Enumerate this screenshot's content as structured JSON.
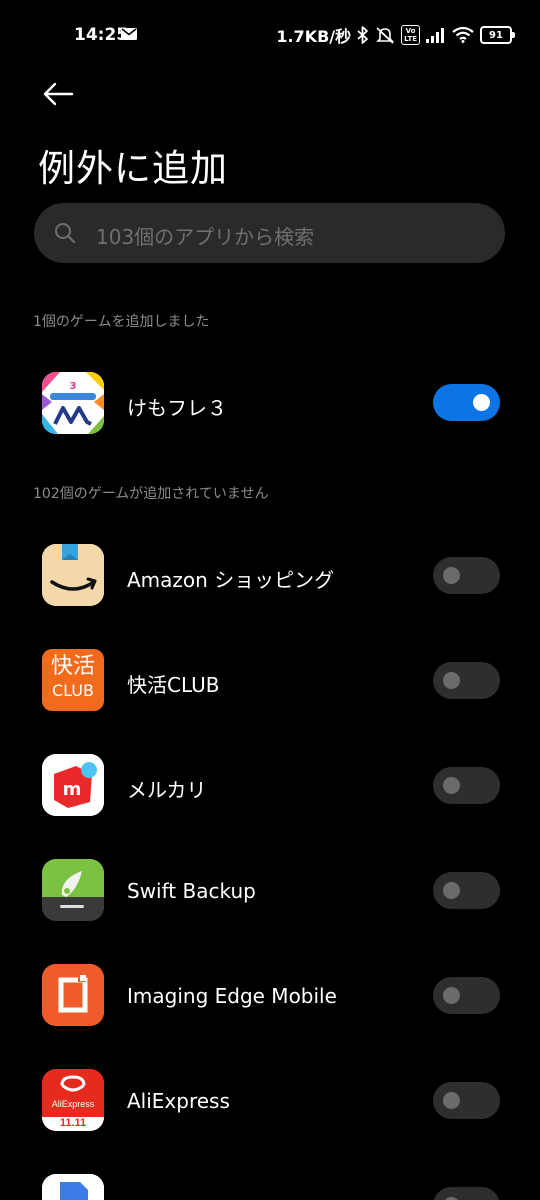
{
  "status_bar": {
    "time": "14:25",
    "net_speed": "1.7KB/秒",
    "battery": "91",
    "volte": "Vo\nLTE"
  },
  "header": {
    "title": "例外に追加"
  },
  "search": {
    "placeholder": "103個のアプリから検索"
  },
  "sections": {
    "added_header": "1個のゲームを追加しました",
    "not_added_header": "102個のゲームが追加されていません"
  },
  "added_apps": [
    {
      "name": "けもフレ３",
      "enabled": true,
      "icon": "kemofure-icon"
    }
  ],
  "apps": [
    {
      "name": "Amazon ショッピング",
      "enabled": false,
      "icon": "amazon-icon"
    },
    {
      "name": "快活CLUB",
      "enabled": false,
      "icon": "kaikatsu-icon",
      "icon_text_1": "快活",
      "icon_text_2": "CLUB"
    },
    {
      "name": "メルカリ",
      "enabled": false,
      "icon": "mercari-icon"
    },
    {
      "name": "Swift Backup",
      "enabled": false,
      "icon": "swift-backup-icon"
    },
    {
      "name": "Imaging Edge Mobile",
      "enabled": false,
      "icon": "imaging-edge-icon"
    },
    {
      "name": "AliExpress",
      "enabled": false,
      "icon": "aliexpress-icon",
      "icon_text_1": "AliExpress",
      "icon_text_2": "11.11"
    }
  ],
  "colors": {
    "background": "#000000",
    "toggle_on": "#0d74e6",
    "toggle_off": "#2e2e2e",
    "search_bg": "#2a2a2a"
  }
}
